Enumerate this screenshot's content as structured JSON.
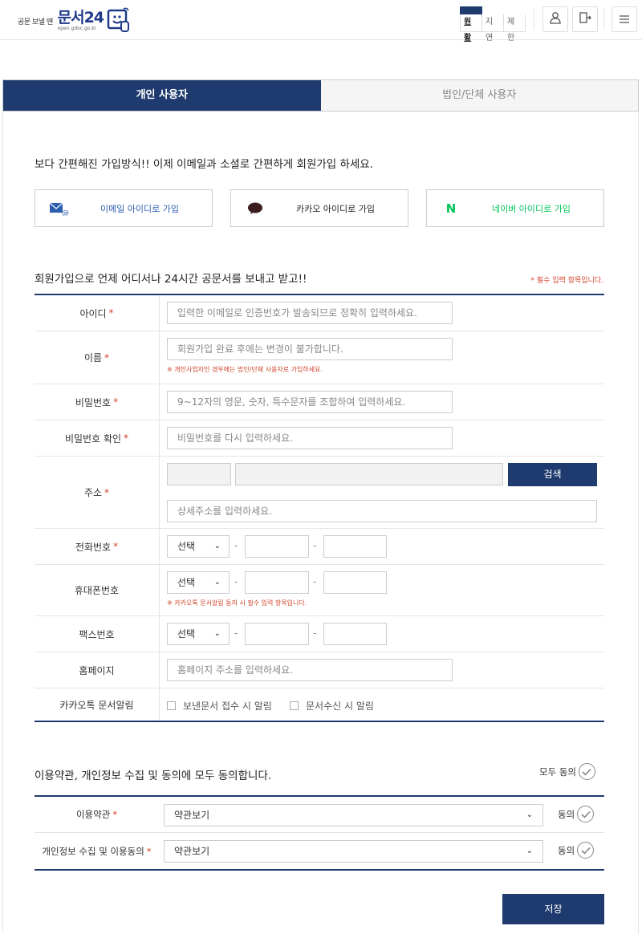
{
  "header": {
    "logo_small": "공문 보낼 땐",
    "logo_title": "문서24",
    "logo_sub": "open.gdoc.go.kr",
    "status_items": [
      "원활",
      "지연",
      "제한"
    ]
  },
  "tabs": [
    {
      "label": "개인 사용자"
    },
    {
      "label": "법인/단체 사용자"
    }
  ],
  "intro": "보다 간편해진 가입방식!! 이제 이메일과 소셜로 간편하게 회원가입 하세요.",
  "social": {
    "email": "이메일 아이디로 가입",
    "kakao": "카카오 아이디로 가입",
    "naver": "네이버 아이디로 가입",
    "naver_letter": "N"
  },
  "form": {
    "title": "회원가입으로 언제 어디서나 24시간 공문서를 보내고 받고!!",
    "required_note": "* 필수 입력 항목입니다.",
    "required_mark": "*",
    "id_label": "아이디",
    "id_placeholder": "입력한 이메일로 인증번호가 발송되므로 정확히 입력하세요.",
    "name_label": "이름",
    "name_placeholder": "회원가입 완료 후에는 변경이 불가합니다.",
    "name_note": "※ 개인사업자인 경우에는 법인/단체 사용자로 가입하세요.",
    "pw_label": "비밀번호",
    "pw_placeholder": "9~12자의 영문, 숫자, 특수문자를 조합하여 입력하세요.",
    "pw_confirm_label": "비밀번호 확인",
    "pw_confirm_placeholder": "비밀번호를 다시 입력하세요.",
    "address_label": "주소",
    "search_label": "검색",
    "address_detail_placeholder": "상세주소를 입력하세요.",
    "phone_label": "전화번호",
    "mobile_label": "휴대폰번호",
    "mobile_note": "※ 카카오톡 문서알림 동의 시 필수 입력 항목입니다.",
    "fax_label": "팩스번호",
    "select_default": "선택",
    "dash": "-",
    "homepage_label": "홈페이지",
    "homepage_placeholder": "홈페이지 주소를 입력하세요.",
    "kakao_alert_label": "카카오톡 문서알림",
    "kakao_alert_opt1": "보낸문서 접수 시 알림",
    "kakao_alert_opt2": "문서수신 시 알림"
  },
  "terms": {
    "title": "이용약관, 개인정보 수집 및 동의에 모두 동의합니다.",
    "agree_all": "모두 동의",
    "agree": "동의",
    "rows": [
      {
        "label": "이용약관",
        "select": "약관보기"
      },
      {
        "label": "개인정보 수집 및 이용동의",
        "select": "약관보기"
      }
    ]
  },
  "save_label": "저장",
  "colors": {
    "primary": "#1f3a6e",
    "required": "#d0452a",
    "naver": "#03c75a"
  }
}
